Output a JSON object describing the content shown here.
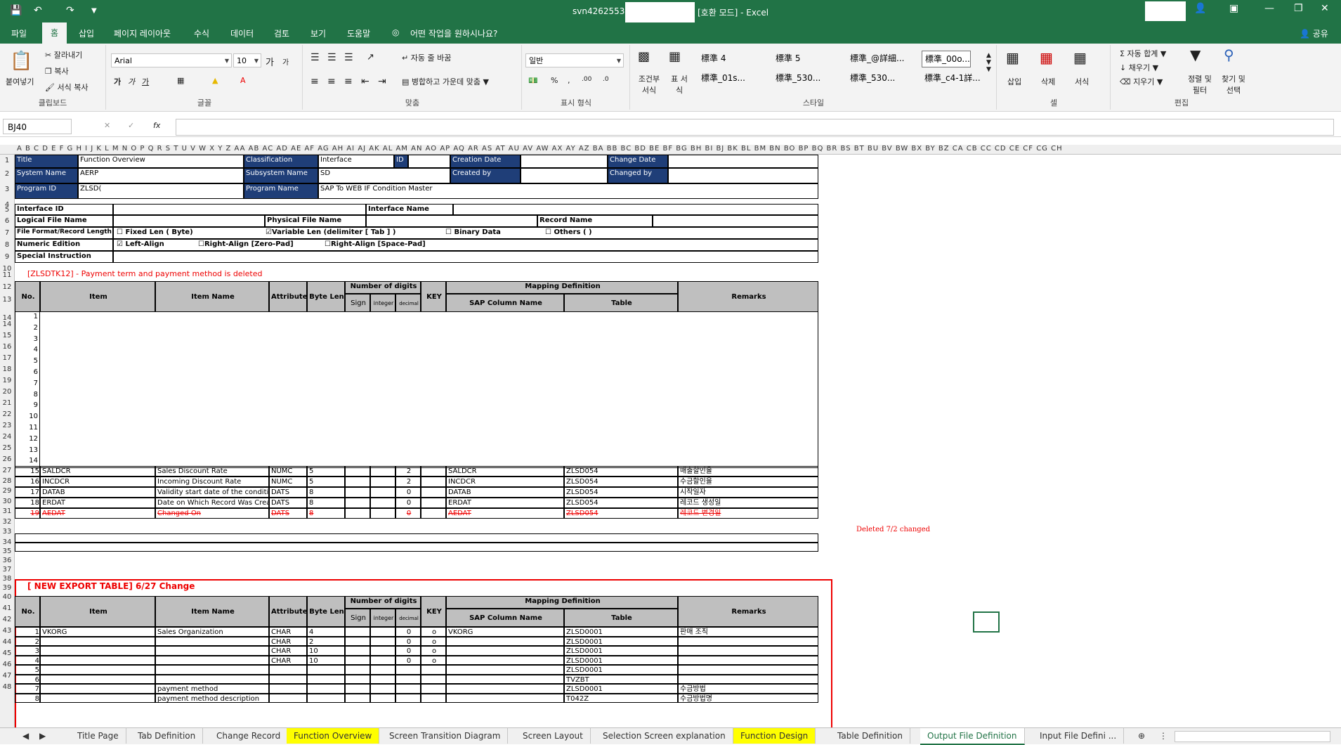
{
  "window": {
    "title": "svn42625532",
    "mode": "[호환 모드] - Excel",
    "share": "공유"
  },
  "ribbon_tabs": [
    "파일",
    "홈",
    "삽입",
    "페이지 레이아웃",
    "수식",
    "데이터",
    "검토",
    "보기",
    "도움말"
  ],
  "tell_me": "어떤 작업을 원하시나요?",
  "clipboard": {
    "paste": "붙여넣기",
    "cut": "잘라내기",
    "copy": "복사",
    "format_painter": "서식 복사",
    "label": "클립보드"
  },
  "font": {
    "name": "Arial",
    "size": "10",
    "bold": "가",
    "italic": "가",
    "underline": "가",
    "label": "글꼴",
    "grow": "가",
    "shrink": "가"
  },
  "alignment": {
    "wrap": "자동 줄 바꿈",
    "merge": "병합하고 가운데 맞춤",
    "label": "맞춤"
  },
  "number": {
    "format": "일반",
    "label": "표시 형식"
  },
  "styles": {
    "conditional": "조건부 서식",
    "table": "표 서식",
    "label": "스타일",
    "items": [
      "標準 4",
      "標準 5",
      "標準_@詳細...",
      "標準_00o...",
      "標準_01s...",
      "標準_530...",
      "標準_530...",
      "標準_c4-1詳..."
    ]
  },
  "cells": {
    "insert": "삽입",
    "delete": "삭제",
    "format": "서식",
    "label": "셀"
  },
  "editing": {
    "autosum": "자동 합계",
    "fill": "채우기",
    "clear": "지우기",
    "sort": "정렬 및 필터",
    "find": "찾기 및 선택",
    "label": "편집"
  },
  "formula_bar": {
    "namebox": "BJ40",
    "fx": "fx"
  },
  "columns": "A B C D E F G H I J K L M N O P Q R S T U V W X Y Z AA AB AC AD AE AF AG AH AI AJ AK AL AM AN AO AP AQ AR AS AT AU AV AW AX AY AZ BA BB BC BD BE BF BG BH BI BJ BK BL BM BN BO BP BQ BR BS BT BU BV BW BX BY BZ CA CB CC CD CE CF CG CH",
  "header": {
    "title_label": "Title",
    "title_value": "Function Overview",
    "class_label": "Classification",
    "class_value": "Interface",
    "id_label": "ID",
    "cdate_label": "Creation Date",
    "chdate_label": "Change Date",
    "sys_label": "System Name",
    "sys_value": "AERP",
    "subsys_label": "Subsystem Name",
    "subsys_value": "SD",
    "createdby_label": "Created by",
    "changedby_label": "Changed by",
    "prog_label": "Program ID",
    "prog_value": "ZLSD(",
    "progname_label": "Program Name",
    "progname_value": "SAP To WEB IF Condition Master"
  },
  "iface": {
    "interface_id": "Interface ID",
    "interface_name": "Interface Name",
    "logical": "Logical File Name",
    "physical": "Physical File Name",
    "record": "Record Name",
    "fileformat": "File Format/Record Length",
    "fixed": "☐ Fixed Len (              Byte)",
    "variable": "☑Variable Len (delimiter [ Tab ] )",
    "binary": "☐ Binary Data",
    "others": "☐    Others (                 )",
    "numeric": "Numeric Edition",
    "leftalign": "☑ Left-Align",
    "rightzero": "☐Right-Align [Zero-Pad]",
    "rightspace": "☐Right-Align [Space-Pad]",
    "special": "Special Instruction"
  },
  "section1": {
    "title": "[ZLSDTK12] - Payment term  and  payment method  is deleted",
    "headers": {
      "no": "No.",
      "item": "Item",
      "itemname": "Item Name",
      "attr": "Attribute",
      "bytelen": "Byte Len",
      "digits": "Number of digits",
      "sign": "Sign",
      "integer": "integer",
      "decimal": "decimal",
      "key": "KEY",
      "mapping": "Mapping Definition",
      "sapcol": "SAP Column Name",
      "table": "Table",
      "remarks": "Remarks"
    },
    "blank_nos": [
      "1",
      "2",
      "3",
      "4",
      "5",
      "6",
      "7",
      "8",
      "9",
      "10",
      "11",
      "12",
      "13",
      "14"
    ],
    "rows": [
      {
        "no": "15",
        "item": "SALDCR",
        "name": "Sales Discount Rate",
        "attr": "NUMC",
        "len": "5",
        "dec": "2",
        "sap": "SALDCR",
        "table": "ZLSD054",
        "rem": "매출할인율"
      },
      {
        "no": "16",
        "item": "INCDCR",
        "name": "Incoming Discount Rate",
        "attr": "NUMC",
        "len": "5",
        "dec": "2",
        "sap": "INCDCR",
        "table": "ZLSD054",
        "rem": "수금할인율"
      },
      {
        "no": "17",
        "item": "DATAB",
        "name": "Validity start date of the condition",
        "attr": "DATS",
        "len": "8",
        "dec": "0",
        "sap": "DATAB",
        "table": "ZLSD054",
        "rem": "시작일자"
      },
      {
        "no": "18",
        "item": "ERDAT",
        "name": "Date on Which Record Was Created",
        "attr": "DATS",
        "len": "8",
        "dec": "0",
        "sap": "ERDAT",
        "table": "ZLSD054",
        "rem": "레코드 생성일"
      },
      {
        "no": "19",
        "item": "AEDAT",
        "name": "Changed On",
        "attr": "DATS",
        "len": "8",
        "dec": "0",
        "sap": "AEDAT",
        "table": "ZLSD054",
        "rem": "레코드 변경일"
      }
    ],
    "deleted_note": "Deleted 7/2 changed"
  },
  "section2": {
    "title": "[ NEW  EXPORT  TABLE]     6/27  Change",
    "rows": [
      {
        "no": "1",
        "item": "VKORG",
        "name": "Sales Organization",
        "attr": "CHAR",
        "len": "4",
        "dec": "0",
        "key": "o",
        "sap": "VKORG",
        "table": "ZLSD0001",
        "rem": "판매 조직"
      },
      {
        "no": "2",
        "item": "",
        "name": "",
        "attr": "CHAR",
        "len": "2",
        "dec": "0",
        "key": "o",
        "sap": "",
        "table": "ZLSD0001",
        "rem": ""
      },
      {
        "no": "3",
        "item": "",
        "name": "",
        "attr": "CHAR",
        "len": "10",
        "dec": "0",
        "key": "o",
        "sap": "",
        "table": "ZLSD0001",
        "rem": ""
      },
      {
        "no": "4",
        "item": "",
        "name": "",
        "attr": "CHAR",
        "len": "10",
        "dec": "0",
        "key": "o",
        "sap": "",
        "table": "ZLSD0001",
        "rem": ""
      },
      {
        "no": "5",
        "item": "",
        "name": "",
        "attr": "",
        "len": "",
        "dec": "",
        "key": "",
        "sap": "",
        "table": "ZLSD0001",
        "rem": ""
      },
      {
        "no": "6",
        "item": "",
        "name": "",
        "attr": "",
        "len": "",
        "dec": "",
        "key": "",
        "sap": "",
        "table": "TVZBT",
        "rem": ""
      },
      {
        "no": "7",
        "item": "",
        "name": "payment method",
        "attr": "",
        "len": "",
        "dec": "",
        "key": "",
        "sap": "",
        "table": "ZLSD0001",
        "rem": "수금방법"
      },
      {
        "no": "8",
        "item": "",
        "name": "payment method description",
        "attr": "",
        "len": "",
        "dec": "",
        "key": "",
        "sap": "",
        "table": "T042Z",
        "rem": "수금방법명"
      }
    ]
  },
  "sheet_tabs": [
    "Title Page",
    "Tab Definition",
    "Change Record",
    "Function Overview",
    "Screen Transition Diagram",
    "Screen Layout",
    "Selection Screen explanation",
    "Function Design",
    "Table Definition",
    "Output File Definition",
    "Input File Defini ..."
  ],
  "colors": {
    "excel_green": "#217346",
    "header_blue": "#1f3e78",
    "header_gray": "#bfbfbf",
    "highlight": "#ffff00",
    "red": "#e00000"
  }
}
